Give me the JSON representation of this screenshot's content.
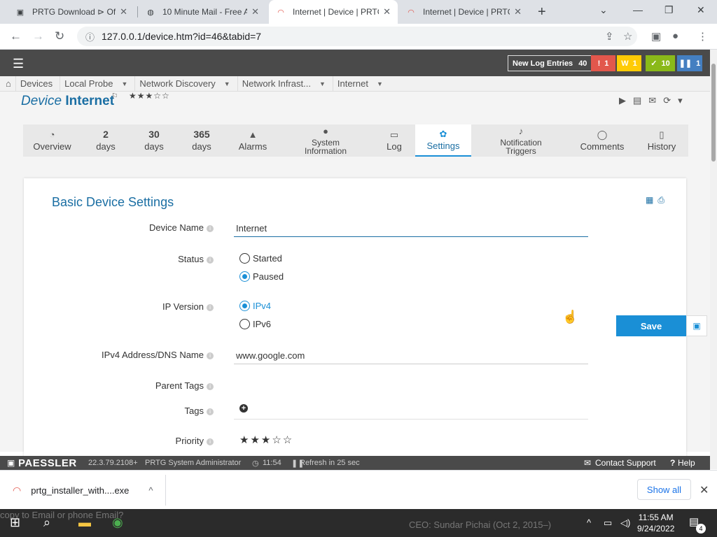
{
  "browser": {
    "tabs": [
      {
        "title": "PRTG Download ⊳ Offi",
        "icon": "prtg-doc-icon"
      },
      {
        "title": "10 Minute Mail - Free A",
        "icon": "globe-icon"
      },
      {
        "title": "Internet | Device | PRTG",
        "icon": "prtg-icon"
      },
      {
        "title": "Internet | Device | PRTG",
        "icon": "prtg-icon"
      }
    ],
    "url": "127.0.0.1/device.htm?id=46&tabid=7"
  },
  "topbar": {
    "log_label": "New Log Entries",
    "log_count": "40",
    "badges": [
      {
        "label": "!",
        "count": "1",
        "color": "#e2574c"
      },
      {
        "label": "W",
        "count": "1",
        "color": "#ffcb05"
      },
      {
        "label": "✓",
        "count": "10",
        "color": "#8ab919"
      },
      {
        "label": "❚❚",
        "count": "1",
        "color": "#447fc1"
      }
    ]
  },
  "breadcrumbs": [
    "Devices",
    "Local Probe",
    "Network Discovery",
    "Network Infrast...",
    "Internet"
  ],
  "device": {
    "prefix": "Device",
    "name": "Internet",
    "stars": "★★★☆☆"
  },
  "page_tabs": [
    {
      "top": "",
      "label": "Overview",
      "icon": "gauge-icon"
    },
    {
      "top": "2",
      "label": "days"
    },
    {
      "top": "30",
      "label": "days"
    },
    {
      "top": "365",
      "label": "days"
    },
    {
      "top": "",
      "label": "Alarms",
      "icon": "warning-icon"
    },
    {
      "top": "",
      "label": "System Information",
      "icon": "info-icon"
    },
    {
      "top": "",
      "label": "Log",
      "icon": "log-icon"
    },
    {
      "top": "",
      "label": "Settings",
      "icon": "gear-icon"
    },
    {
      "top": "",
      "label": "Notification Triggers",
      "icon": "bell-icon"
    },
    {
      "top": "",
      "label": "Comments",
      "icon": "comment-icon"
    },
    {
      "top": "",
      "label": "History",
      "icon": "history-icon"
    }
  ],
  "settings": {
    "section_title": "Basic Device Settings",
    "device_name_label": "Device Name",
    "device_name_value": "Internet",
    "status_label": "Status",
    "status_options": [
      "Started",
      "Paused"
    ],
    "status_selected": "Paused",
    "ip_version_label": "IP Version",
    "ip_options": [
      "IPv4",
      "IPv6"
    ],
    "ip_selected": "IPv4",
    "address_label": "IPv4 Address/DNS Name",
    "address_value": "www.google.com",
    "parent_tags_label": "Parent Tags",
    "tags_label": "Tags",
    "priority_label": "Priority",
    "priority_stars": "★★★☆☆",
    "save_label": "Save"
  },
  "footer": {
    "brand": "PAESSLER",
    "version": "22.3.79.2108+",
    "user": "PRTG System Administrator",
    "time": "11:54",
    "refresh": "Refresh in 25 sec",
    "contact": "Contact Support",
    "help": "Help"
  },
  "download": {
    "file": "prtg_installer_with....exe",
    "show_all": "Show all"
  },
  "taskbar": {
    "time": "11:55 AM",
    "date": "9/24/2022",
    "notifications": "4",
    "ghost_left": "copy to Email or phone Email?",
    "ghost_right": "CEO: Sundar Pichai (Oct 2, 2015–)"
  }
}
